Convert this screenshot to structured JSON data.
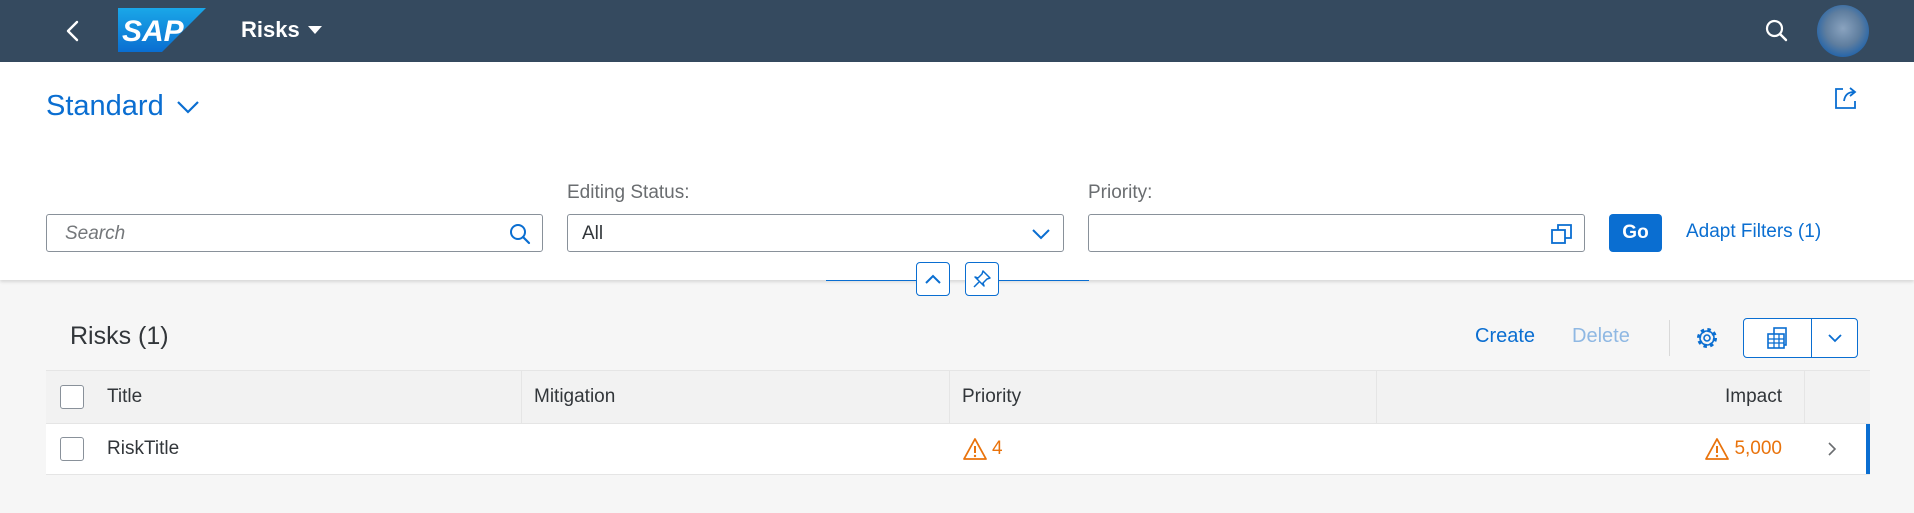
{
  "shell": {
    "app_title": "Risks",
    "logo_text": "SAP"
  },
  "filterbar": {
    "variant_name": "Standard",
    "search_placeholder": "Search",
    "editing_status_label": "Editing Status:",
    "editing_status_value": "All",
    "priority_label": "Priority:",
    "priority_value": "",
    "go_label": "Go",
    "adapt_filters_label": "Adapt Filters (1)"
  },
  "table": {
    "title": "Risks (1)",
    "create_label": "Create",
    "delete_label": "Delete",
    "columns": [
      "Title",
      "Mitigation",
      "Priority",
      "Impact"
    ],
    "rows": [
      {
        "title": "RiskTitle",
        "mitigation": "",
        "priority": "4",
        "impact": "5,000"
      }
    ]
  },
  "colors": {
    "shell": "#354a5f",
    "accent": "#0a6ed1",
    "critical": "#e9730c",
    "disabled_link": "#8fb8e3"
  }
}
